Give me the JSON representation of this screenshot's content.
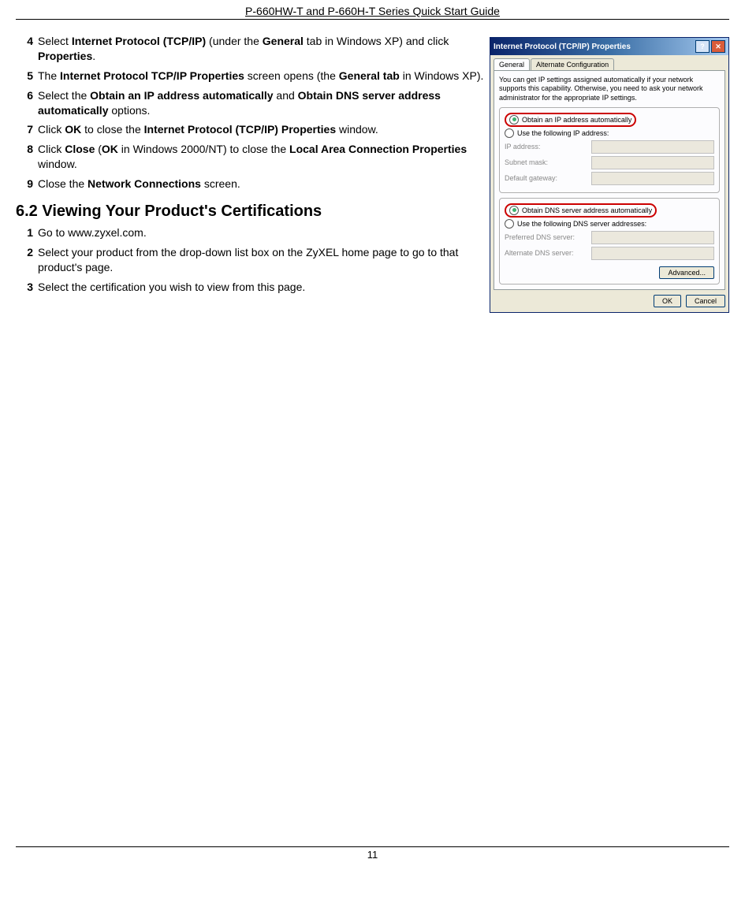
{
  "header": "P-660HW-T and P-660H-T Series Quick Start Guide",
  "pageNumber": "11",
  "stepsA": [
    {
      "n": "4",
      "parts": [
        "Select ",
        "Internet Protocol (TCP/IP)",
        " (under the ",
        "General",
        " tab in Windows XP) and click ",
        "Properties",
        "."
      ]
    },
    {
      "n": "5",
      "parts": [
        "The ",
        "Internet Protocol TCP/IP Properties",
        " screen opens (the ",
        "General tab",
        " in Windows XP)."
      ]
    },
    {
      "n": "6",
      "parts": [
        "Select the ",
        "Obtain an IP address automatically",
        " and ",
        "Obtain DNS server address automatically",
        " options."
      ]
    },
    {
      "n": "7",
      "parts": [
        "Click ",
        "OK",
        " to close the ",
        "Internet Protocol (TCP/IP) Properties",
        " window."
      ]
    },
    {
      "n": "8",
      "parts": [
        "Click ",
        "Close",
        " (",
        "OK",
        " in Windows 2000/NT) to close the ",
        "Local Area Connection Properties",
        " window."
      ]
    },
    {
      "n": "9",
      "parts": [
        "Close the ",
        "Network Connections",
        " screen."
      ]
    }
  ],
  "sectionHeading": "6.2 Viewing Your Product's Certifications",
  "stepsB": [
    {
      "n": "1",
      "plain": "Go to www.zyxel.com."
    },
    {
      "n": "2",
      "plain": "Select your product from the drop-down list box on the ZyXEL home page to go to that product's page."
    },
    {
      "n": "3",
      "plain": "Select the certification you wish to view from this page."
    }
  ],
  "dialog": {
    "title": "Internet Protocol (TCP/IP) Properties",
    "helpBtn": "?",
    "closeBtn": "✕",
    "tabs": [
      "General",
      "Alternate Configuration"
    ],
    "desc": "You can get IP settings assigned automatically if your network supports this capability. Otherwise, you need to ask your network administrator for the appropriate IP settings.",
    "r1": "Obtain an IP address automatically",
    "r2": "Use the following IP address:",
    "f1": "IP address:",
    "f2": "Subnet mask:",
    "f3": "Default gateway:",
    "r3": "Obtain DNS server address automatically",
    "r4": "Use the following DNS server addresses:",
    "f4": "Preferred DNS server:",
    "f5": "Alternate DNS server:",
    "advanced": "Advanced...",
    "ok": "OK",
    "cancel": "Cancel"
  }
}
